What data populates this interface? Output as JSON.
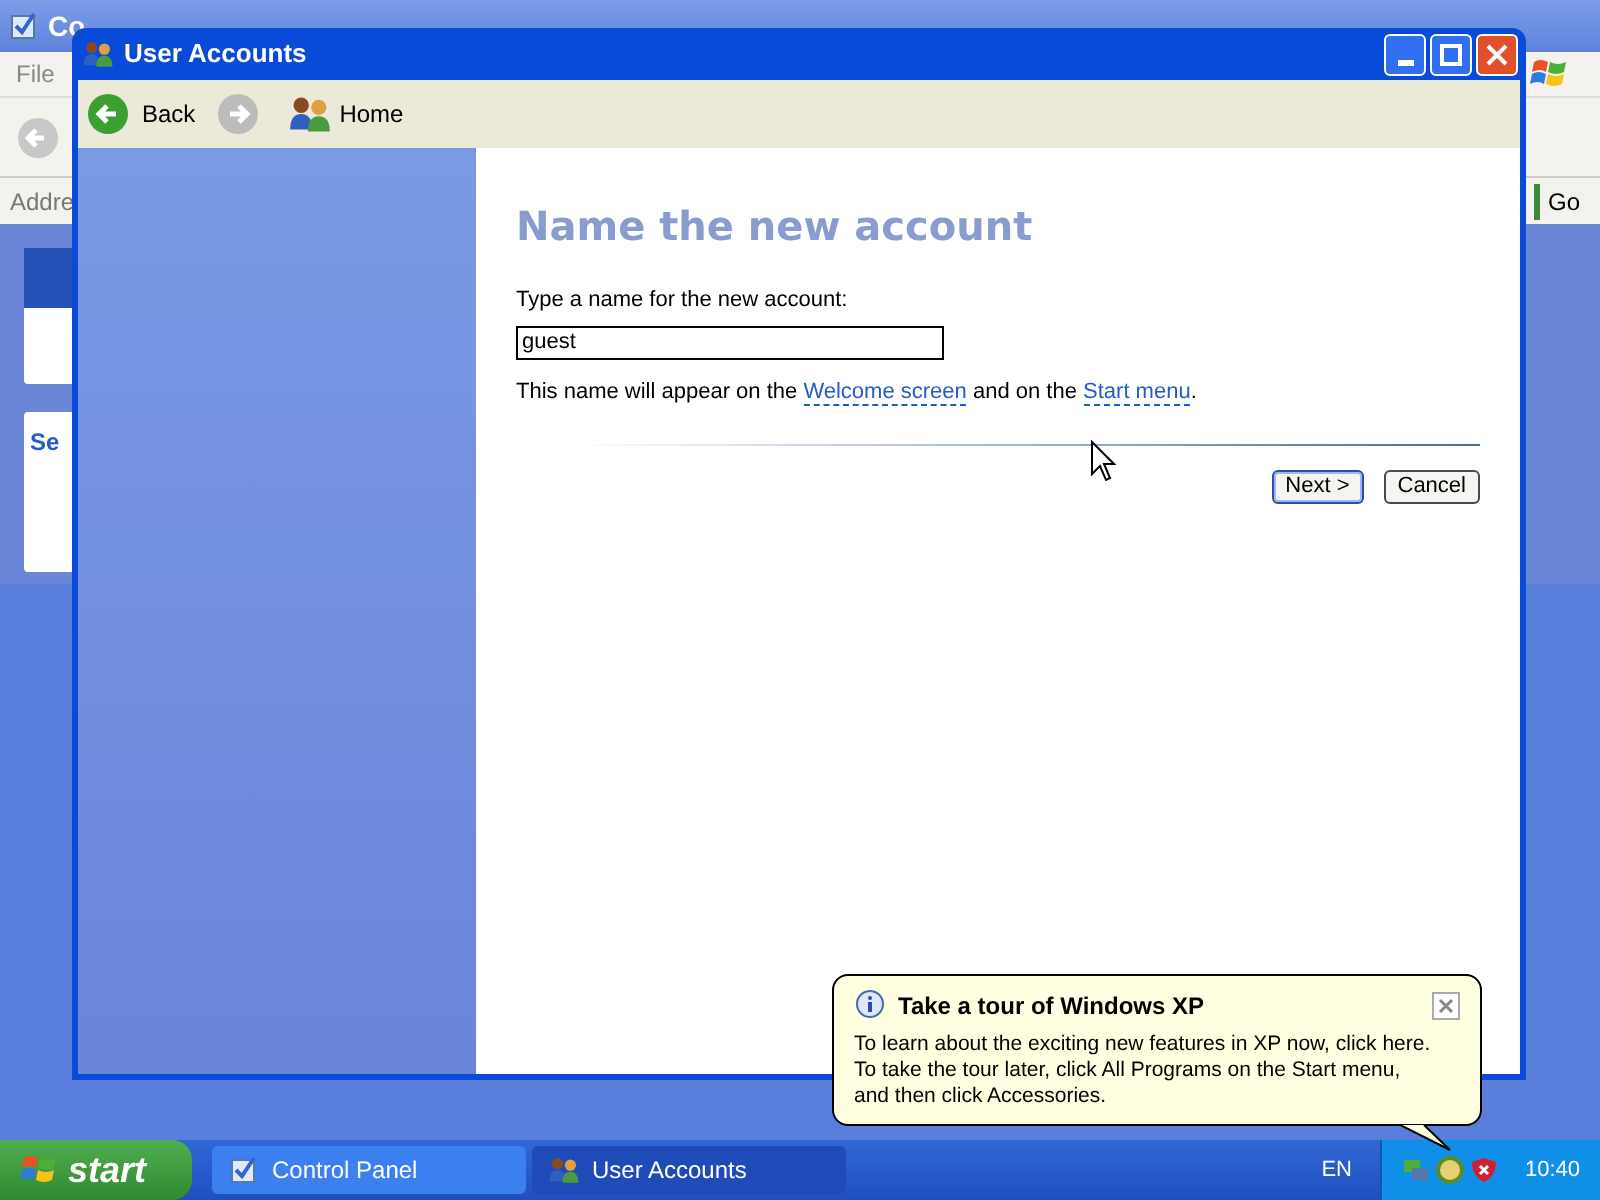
{
  "background_window": {
    "title": "Co",
    "menu": [
      "File"
    ],
    "address_label": "Addre",
    "go_button": "Go",
    "panel_heading": "Se"
  },
  "window": {
    "title": "User Accounts",
    "toolbar": {
      "back": "Back",
      "home": "Home"
    },
    "heading": "Name the new account",
    "field_label": "Type a name for the new account:",
    "name_field": {
      "value": "guest"
    },
    "note": {
      "before": "This name will appear on the ",
      "link_1": "Welcome screen",
      "middle": " and on the ",
      "link_2": "Start menu",
      "after": "."
    },
    "buttons": [
      {
        "label": "Next >",
        "default": true
      },
      {
        "label": "Cancel",
        "default": false
      }
    ]
  },
  "balloon": {
    "title": "Take a tour of Windows XP",
    "text": [
      "To learn about the exciting new features in XP now, click here.",
      "To take the tour later, click All Programs on the Start menu,",
      "and then click Accessories."
    ]
  },
  "taskbar": {
    "start": "start",
    "tasks": [
      {
        "label": "Control Panel",
        "selected": false,
        "kind": "panel"
      },
      {
        "label": "User Accounts",
        "selected": true,
        "kind": "users"
      }
    ],
    "language": "EN",
    "clock": "10:40"
  }
}
